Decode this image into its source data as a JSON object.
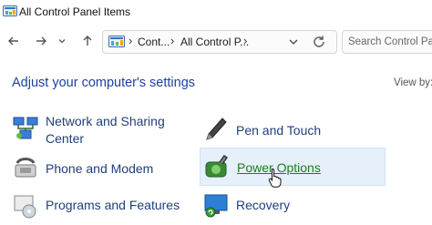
{
  "window": {
    "title": "All Control Panel Items"
  },
  "navigation": {
    "back": "back",
    "forward": "forward",
    "recent": "recent-locations",
    "up": "up"
  },
  "address": {
    "crumbs": [
      "Cont...",
      "All Control P..."
    ]
  },
  "search": {
    "placeholder": "Search Control Panel"
  },
  "main": {
    "heading": "Adjust your computer's settings",
    "view_by": "View by:"
  },
  "items": [
    {
      "label": "Network and Sharing Center",
      "icon": "network-icon"
    },
    {
      "label": "Pen and Touch",
      "icon": "pen-icon"
    },
    {
      "label": "Phone and Modem",
      "icon": "phone-modem-icon"
    },
    {
      "label": "Power Options",
      "icon": "power-options-icon",
      "hovered": true
    },
    {
      "label": "Programs and Features",
      "icon": "programs-icon"
    },
    {
      "label": "Recovery",
      "icon": "recovery-icon"
    }
  ],
  "colors": {
    "link": "#1f3f7a",
    "heading": "#1f3f9e",
    "hover_link": "#1a7f1a",
    "hover_bg": "#e6f0fb"
  }
}
